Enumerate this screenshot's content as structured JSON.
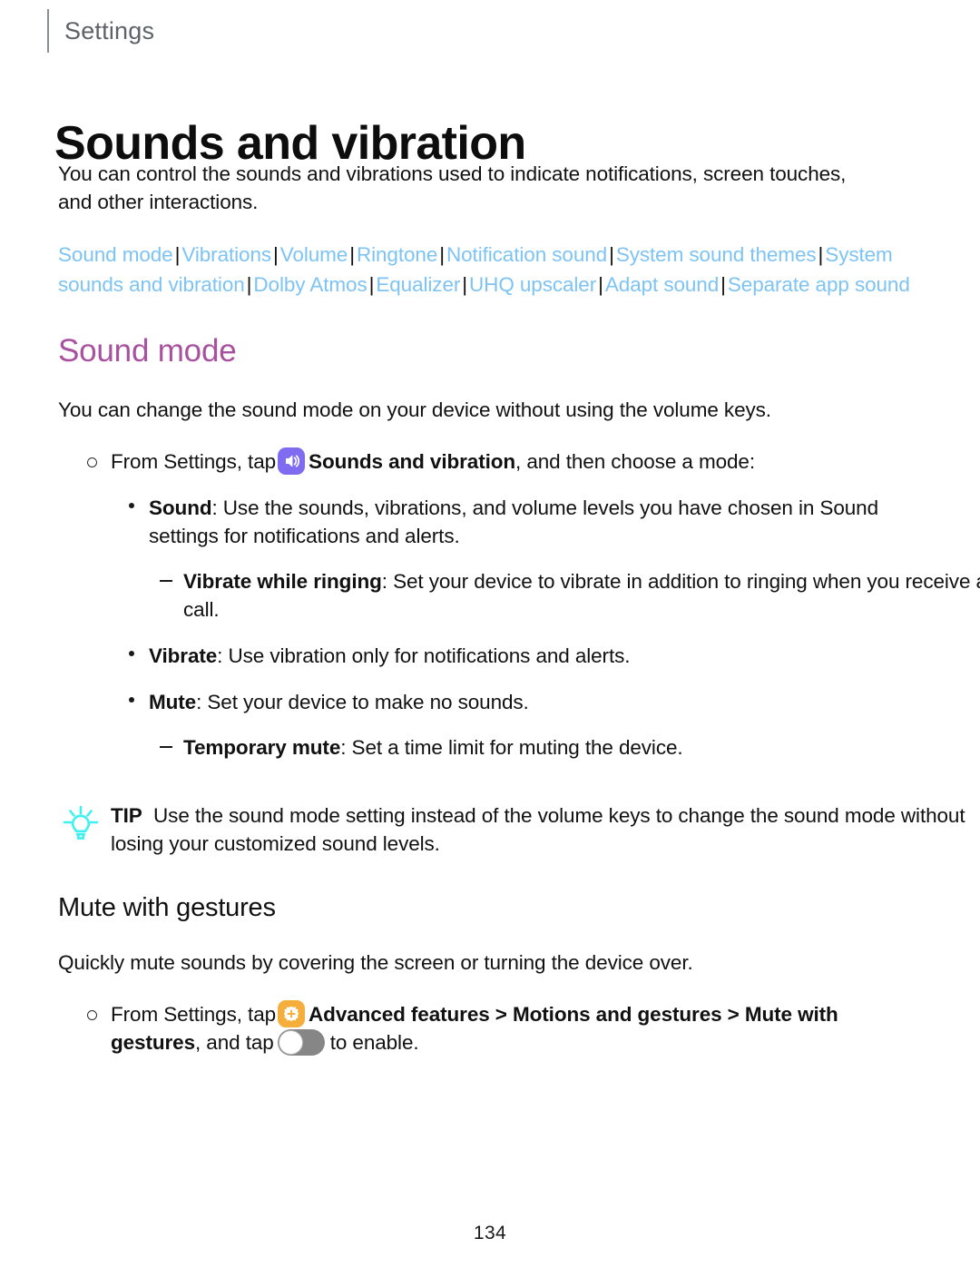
{
  "header": {
    "breadcrumb": "Settings"
  },
  "title": "Sounds and vibration",
  "intro": "You can control the sounds and vibrations used to indicate notifications, screen touches, and other interactions.",
  "related_links": [
    "Sound mode",
    "Vibrations",
    "Volume",
    "Ringtone",
    "Notification sound",
    "System sound themes",
    "System sounds and vibration",
    "Dolby Atmos",
    "Equalizer",
    "UHQ upscaler",
    "Adapt sound",
    "Separate app sound"
  ],
  "link_separator": "|",
  "sections": [
    {
      "heading": "Sound mode",
      "intro": "You can change the sound mode on your device without using the volume keys.",
      "step": {
        "lead": "From Settings, tap",
        "icon": "sound-and-vibration-icon",
        "bold": "Sounds and vibration",
        "tail": ", and then choose a mode:"
      },
      "items": [
        {
          "level": "bullet",
          "term": "Sound",
          "desc": ": Use the sounds, vibrations, and volume levels you have chosen in Sound settings for notifications and alerts."
        },
        {
          "level": "subbullet",
          "term": "Vibrate while ringing",
          "desc": ": Set your device to vibrate in addition to ringing when you receive a call."
        },
        {
          "level": "bullet",
          "term": "Vibrate",
          "desc": ": Use vibration only for notifications and alerts."
        },
        {
          "level": "bullet",
          "term": "Mute",
          "desc": ": Set your device to make no sounds."
        },
        {
          "level": "subbullet",
          "term": "Temporary mute",
          "desc": ": Set a time limit for muting the device."
        }
      ],
      "tip": {
        "icon": "lightbulb-icon",
        "label": "TIP",
        "text": "Use the sound mode setting instead of the volume keys to change the sound mode without losing your customized sound levels."
      }
    },
    {
      "heading": "Mute with gestures",
      "intro": "Quickly mute sounds by covering the screen or turning the device over.",
      "step": {
        "lead": "From Settings, tap",
        "icon": "advanced-features-icon",
        "bold": "Advanced features > Motions and gestures > Mute with gestures",
        "middle": ", and tap",
        "toggle": "toggle-switch-off",
        "tail": "to enable."
      }
    }
  ],
  "footer": {
    "page_number": "134"
  },
  "colors": {
    "link": "#7dc3f4",
    "section_heading": "#a7519f",
    "breadcrumb": "#5d6368",
    "sound_icon_bg": "#7e6bf0",
    "advanced_icon_bg": "#f5ae3c",
    "tip_icon": "#3ef0f0",
    "toggle_off": "#868686"
  }
}
